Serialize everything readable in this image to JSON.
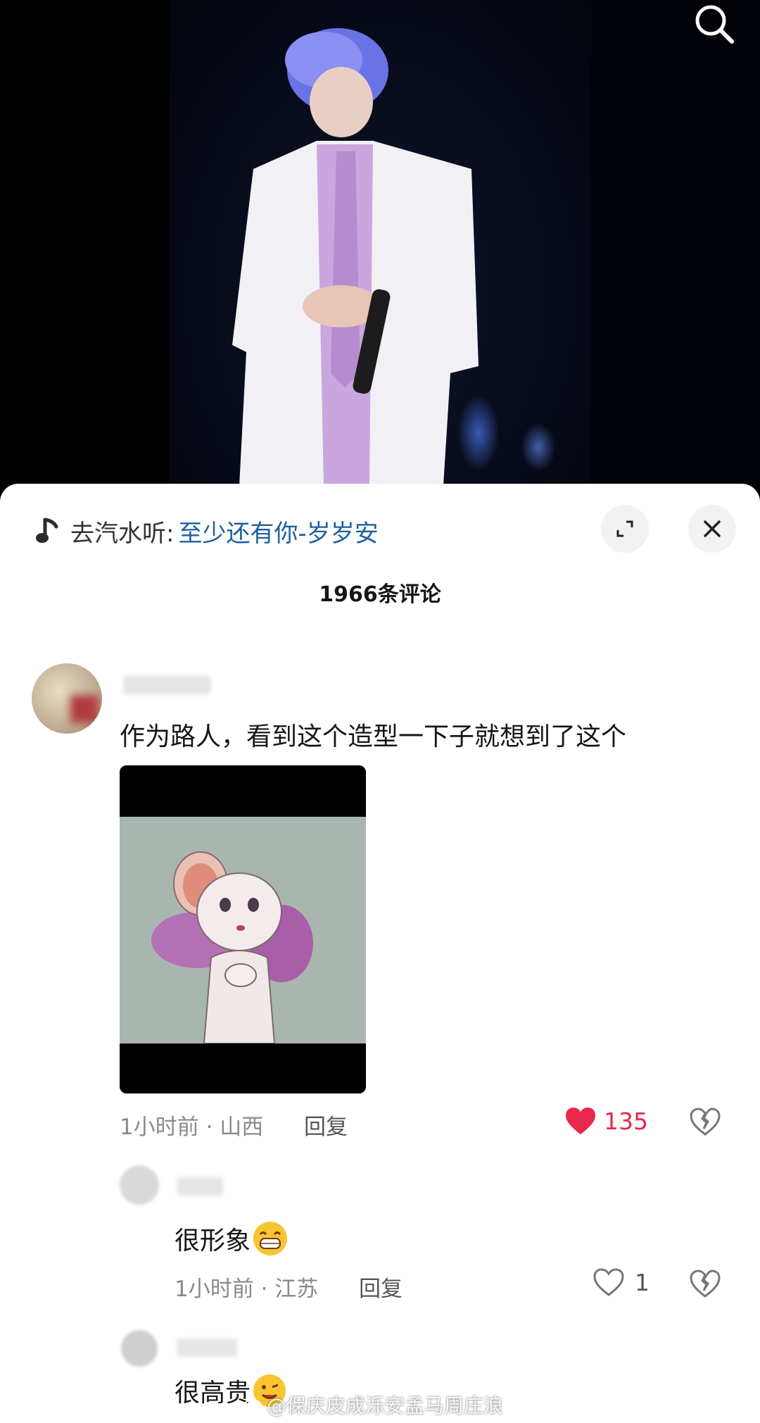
{
  "music": {
    "prefix": "去汽水听:",
    "song": "至少还有你-岁岁安"
  },
  "comments_title": "1966条评论",
  "comments": [
    {
      "text": "作为路人，看到这个造型一下子就想到了这个",
      "meta": "1小时前 · 山西",
      "reply_label": "回复",
      "likes": "135",
      "liked": true
    }
  ],
  "replies": [
    {
      "text": "很形象",
      "emoji": "grin-emoji",
      "meta": "1小时前 · 江苏",
      "reply_label": "回复",
      "likes": "1",
      "liked": false
    },
    {
      "text": "很高贵",
      "emoji": "wink-emoji"
    }
  ],
  "watermark": "@保庆皮成泺安孟马周庄浪",
  "colors": {
    "link": "#1f5f9e",
    "liked_heart": "#e8284a",
    "sheet_bg": "#ffffff"
  }
}
